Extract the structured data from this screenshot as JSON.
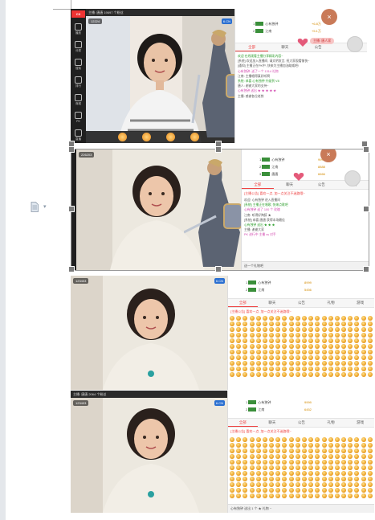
{
  "shots": [
    {
      "topbar": "主播: 唐唐 19697 个粉丝",
      "room_tag": "12224",
      "logo": "CX",
      "kcn": "6.CN",
      "sidebar": [
        "播放",
        "分类",
        "搜索",
        "排行",
        "商城",
        "PK",
        "直播"
      ],
      "rank": [
        {
          "n": "1",
          "name": "心有独钟",
          "coin": "+6.8万"
        },
        {
          "n": "2",
          "name": "江南",
          "coin": "+5.1万"
        }
      ],
      "tabs": [
        "全部",
        "聊天",
        "公告",
        "礼物"
      ],
      "pill": "主播: 唐人家",
      "close": "×",
      "messages": [
        {
          "c": "gr",
          "t": "欢迎 在线观看主播分享精彩内容~"
        },
        {
          "c": "",
          "t": "[系统] 欢迎加入直播间, 请文明发言, 祝大家观看愉快~"
        },
        {
          "c": "",
          "t": "[通知] 主播正在PK中, 快来为主播加油助威吧!"
        },
        {
          "c": "pk",
          "t": "心有独钟: 送了一个 1314 礼物"
        },
        {
          "c": "",
          "t": "江南: 主播唱得真好听啊"
        },
        {
          "c": "gr",
          "t": "系统: 恭喜 心有独钟 升级到 V8"
        },
        {
          "c": "",
          "t": "唐人: 谢谢大家的支持~"
        },
        {
          "c": "pk",
          "t": "心有独钟 送出 ★ ★ ★ ★ ★"
        },
        {
          "c": "",
          "t": "主播: 感谢各位老铁"
        }
      ]
    },
    {
      "room_tag": "226203",
      "rank": [
        {
          "n": "1",
          "name": "心有独钟",
          "coin": "9999"
        },
        {
          "n": "2",
          "name": "江南",
          "coin": "8888"
        },
        {
          "n": "3",
          "name": "唐唐",
          "coin": "6666"
        }
      ],
      "tabs": [
        "全部",
        "聊天",
        "公告",
        "礼物"
      ],
      "notice": "[主播公告] 喜欢一点, 加一点关注不迷路哦~",
      "messages": [
        {
          "c": "",
          "t": "欢迎: 心有独钟 进入直播间"
        },
        {
          "c": "gr",
          "t": "[系统] 主播正在唱歌, 快来点歌吧"
        },
        {
          "c": "pk",
          "t": "心有独钟 送了 100 个 玫瑰"
        },
        {
          "c": "",
          "t": "江南: 听得好陶醉 ★"
        },
        {
          "c": "",
          "t": "[系统] 恭喜 唐唐 获得本场最佳"
        },
        {
          "c": "gr",
          "t": "心有独钟 送出 ★ ★ ★"
        },
        {
          "c": "",
          "t": "主播: 谢谢大家"
        },
        {
          "c": "pk",
          "t": "PK 进行中 主播 vs 对手"
        }
      ],
      "bottom": "送一个礼物吧"
    },
    {
      "room_tag": "123403",
      "kcn": "6.CN",
      "rank": [
        {
          "n": "1",
          "name": "心有独钟",
          "coin": "8999"
        },
        {
          "n": "2",
          "name": "江南",
          "coin": "5456"
        }
      ],
      "tabs": [
        "全部",
        "聊天",
        "公告",
        "礼物",
        "游戏"
      ],
      "notice": "[主播公告] 喜欢一点, 加一点关注不迷路哦~"
    },
    {
      "topbar": "主播: 唐唐 2064 个粉丝",
      "room_tag": "123403",
      "kcn": "6.CN",
      "rank": [
        {
          "n": "1",
          "name": "心有独钟",
          "coin": "9999"
        },
        {
          "n": "2",
          "name": "江南",
          "coin": "6452"
        }
      ],
      "tabs": [
        "全部",
        "聊天",
        "公告",
        "礼物",
        "游戏"
      ],
      "notice": "[主播公告] 喜欢一点, 加一点关注不迷路哦~",
      "bottom": "心有独钟 送出 1 个 ★ 礼物 ~"
    }
  ]
}
